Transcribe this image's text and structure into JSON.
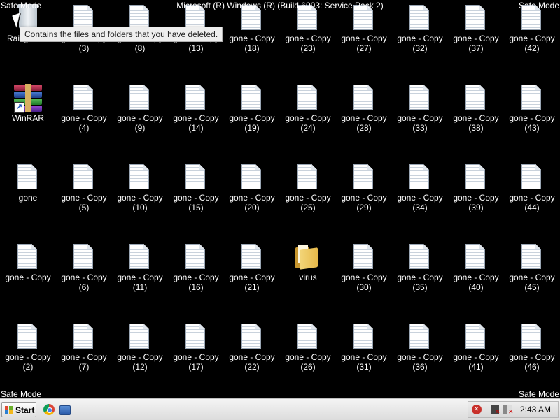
{
  "window_title": "Microsoft (R) Windows (R) (Build 6003: Service Pack 2)",
  "mode_text": "Safe Mode",
  "tooltip": "Contains the files and folders that you have deleted.",
  "desktop_icons": [
    {
      "kind": "recycle",
      "label1": "Rail games",
      "label2": ""
    },
    {
      "kind": "winrar",
      "label1": "WinRAR",
      "label2": ""
    },
    {
      "kind": "doc",
      "label1": "gone",
      "label2": ""
    },
    {
      "kind": "doc",
      "label1": "gone - Copy",
      "label2": ""
    },
    {
      "kind": "doc",
      "label1": "gone - Copy",
      "label2": "(2)"
    },
    {
      "kind": "doc",
      "label1": "gone - Copy",
      "label2": "(3)"
    },
    {
      "kind": "doc",
      "label1": "gone - Copy",
      "label2": "(4)"
    },
    {
      "kind": "doc",
      "label1": "gone - Copy",
      "label2": "(5)"
    },
    {
      "kind": "doc",
      "label1": "gone - Copy",
      "label2": "(6)"
    },
    {
      "kind": "doc",
      "label1": "gone - Copy",
      "label2": "(7)"
    },
    {
      "kind": "doc",
      "label1": "gone - Copy",
      "label2": "(8)"
    },
    {
      "kind": "doc",
      "label1": "gone - Copy",
      "label2": "(9)"
    },
    {
      "kind": "doc",
      "label1": "gone - Copy",
      "label2": "(10)"
    },
    {
      "kind": "doc",
      "label1": "gone - Copy",
      "label2": "(11)"
    },
    {
      "kind": "doc",
      "label1": "gone - Copy",
      "label2": "(12)"
    },
    {
      "kind": "doc",
      "label1": "gone - Copy",
      "label2": "(13)"
    },
    {
      "kind": "doc",
      "label1": "gone - Copy",
      "label2": "(14)"
    },
    {
      "kind": "doc",
      "label1": "gone - Copy",
      "label2": "(15)"
    },
    {
      "kind": "doc",
      "label1": "gone - Copy",
      "label2": "(16)"
    },
    {
      "kind": "doc",
      "label1": "gone - Copy",
      "label2": "(17)"
    },
    {
      "kind": "doc",
      "label1": "gone - Copy",
      "label2": "(18)"
    },
    {
      "kind": "doc",
      "label1": "gone - Copy",
      "label2": "(19)"
    },
    {
      "kind": "doc",
      "label1": "gone - Copy",
      "label2": "(20)"
    },
    {
      "kind": "doc",
      "label1": "gone - Copy",
      "label2": "(21)"
    },
    {
      "kind": "doc",
      "label1": "gone - Copy",
      "label2": "(22)"
    },
    {
      "kind": "doc",
      "label1": "gone - Copy",
      "label2": "(23)"
    },
    {
      "kind": "doc",
      "label1": "gone - Copy",
      "label2": "(24)"
    },
    {
      "kind": "doc",
      "label1": "gone - Copy",
      "label2": "(25)"
    },
    {
      "kind": "folder",
      "label1": "virus",
      "label2": ""
    },
    {
      "kind": "doc",
      "label1": "gone - Copy",
      "label2": "(26)"
    },
    {
      "kind": "doc",
      "label1": "gone - Copy",
      "label2": "(27)"
    },
    {
      "kind": "doc",
      "label1": "gone - Copy",
      "label2": "(28)"
    },
    {
      "kind": "doc",
      "label1": "gone - Copy",
      "label2": "(29)"
    },
    {
      "kind": "doc",
      "label1": "gone - Copy",
      "label2": "(30)"
    },
    {
      "kind": "doc",
      "label1": "gone - Copy",
      "label2": "(31)"
    },
    {
      "kind": "doc",
      "label1": "gone - Copy",
      "label2": "(32)"
    },
    {
      "kind": "doc",
      "label1": "gone - Copy",
      "label2": "(33)"
    },
    {
      "kind": "doc",
      "label1": "gone - Copy",
      "label2": "(34)"
    },
    {
      "kind": "doc",
      "label1": "gone - Copy",
      "label2": "(35)"
    },
    {
      "kind": "doc",
      "label1": "gone - Copy",
      "label2": "(36)"
    },
    {
      "kind": "doc",
      "label1": "gone - Copy",
      "label2": "(37)"
    },
    {
      "kind": "doc",
      "label1": "gone - Copy",
      "label2": "(38)"
    },
    {
      "kind": "doc",
      "label1": "gone - Copy",
      "label2": "(39)"
    },
    {
      "kind": "doc",
      "label1": "gone - Copy",
      "label2": "(40)"
    },
    {
      "kind": "doc",
      "label1": "gone - Copy",
      "label2": "(41)"
    },
    {
      "kind": "doc",
      "label1": "gone - Copy",
      "label2": "(42)"
    },
    {
      "kind": "doc",
      "label1": "gone - Copy",
      "label2": "(43)"
    },
    {
      "kind": "doc",
      "label1": "gone - Copy",
      "label2": "(44)"
    },
    {
      "kind": "doc",
      "label1": "gone - Copy",
      "label2": "(45)"
    },
    {
      "kind": "doc",
      "label1": "gone - Copy",
      "label2": "(46)"
    }
  ],
  "taskbar": {
    "start_label": "Start",
    "quick_launch": [
      "chrome-icon",
      "show-desktop-icon"
    ],
    "tray_icons": [
      "security-alert-icon",
      "network-disconnected-icon",
      "volume-muted-icon"
    ],
    "clock": "2:43 AM"
  }
}
